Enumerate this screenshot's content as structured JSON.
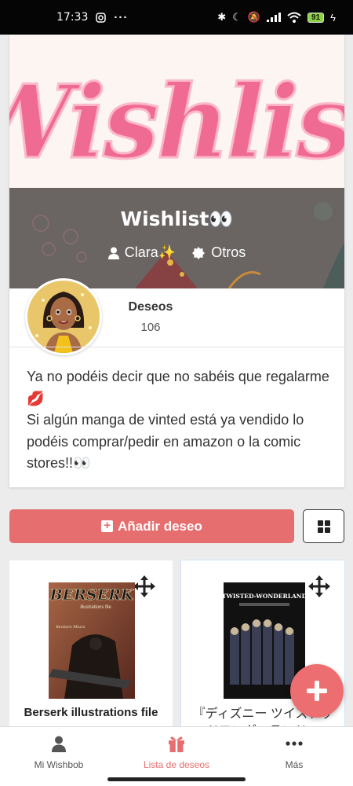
{
  "status_bar": {
    "time": "17:33",
    "battery": "91",
    "icons": [
      "instagram-icon",
      "more-icon",
      "bluetooth-icon",
      "moon-icon",
      "mute-icon",
      "signal-icon",
      "wifi-icon",
      "battery-icon",
      "charging-icon"
    ]
  },
  "wishlist": {
    "banner_text": "Wishlist",
    "title": "Wishlist👀",
    "owner": "Clara✨",
    "category": "Otros",
    "stats_label": "Deseos",
    "stats_count": "106",
    "description": [
      "Ya no podéis decir que no sabéis que regalarme💋",
      "Si algún manga de vinted está ya vendido lo podéis comprar/pedir en amazon o la comic stores!!👀"
    ]
  },
  "actions": {
    "add_label": "Añadir deseo",
    "add_icon": "plus-square-icon",
    "grid_icon": "grid-icon"
  },
  "items": [
    {
      "title": "Berserk illustrations file",
      "cover_title": "BERSERK",
      "cover_subtitle": "illustrations file",
      "cover_author": "Kentaro Miura"
    },
    {
      "title": "『ディズニー ツイステッドワンダーランド』",
      "cover_title": "TWISTED-WONDERLAND"
    }
  ],
  "bottom_nav": [
    {
      "label": "Mi Wishbob",
      "icon": "user-icon"
    },
    {
      "label": "Lista de deseos",
      "icon": "gift-icon",
      "active": true
    },
    {
      "label": "Más",
      "icon": "more-icon"
    }
  ],
  "colors": {
    "accent": "#e76e6f",
    "banner_bg": "#fcf5f1",
    "banner_script": "#f06b94",
    "banner_dark": "#6a6463"
  }
}
